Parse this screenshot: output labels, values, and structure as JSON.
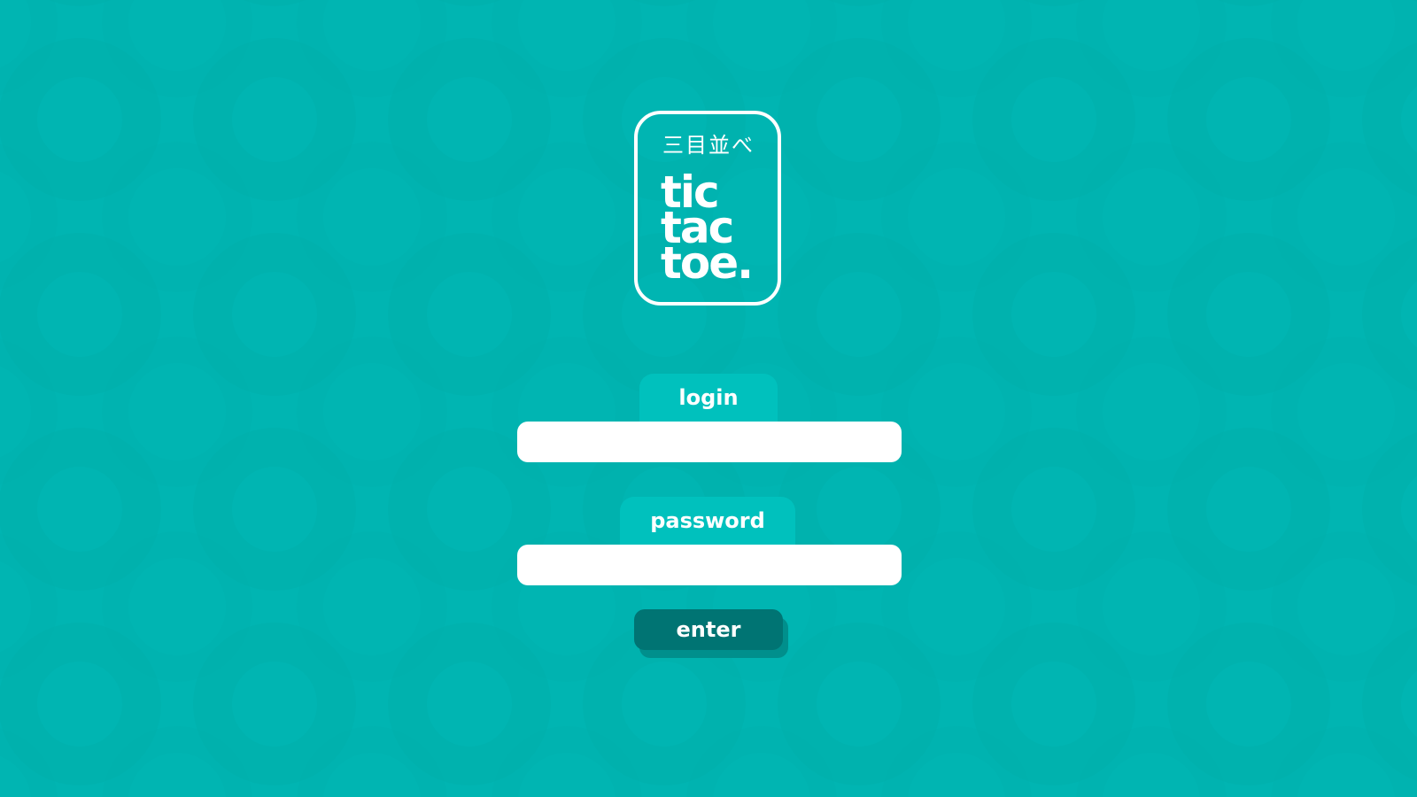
{
  "theme": {
    "background": "#00b5b2",
    "tab_color": "#00c1bd",
    "button_color": "#007473",
    "button_shadow": "#008f8c"
  },
  "logo": {
    "japanese": "三目並べ",
    "line1": "tic",
    "line2": "tac",
    "line3": "toe."
  },
  "form": {
    "login_label": "login",
    "login_value": "",
    "password_label": "password",
    "password_value": "",
    "enter_label": "enter"
  }
}
